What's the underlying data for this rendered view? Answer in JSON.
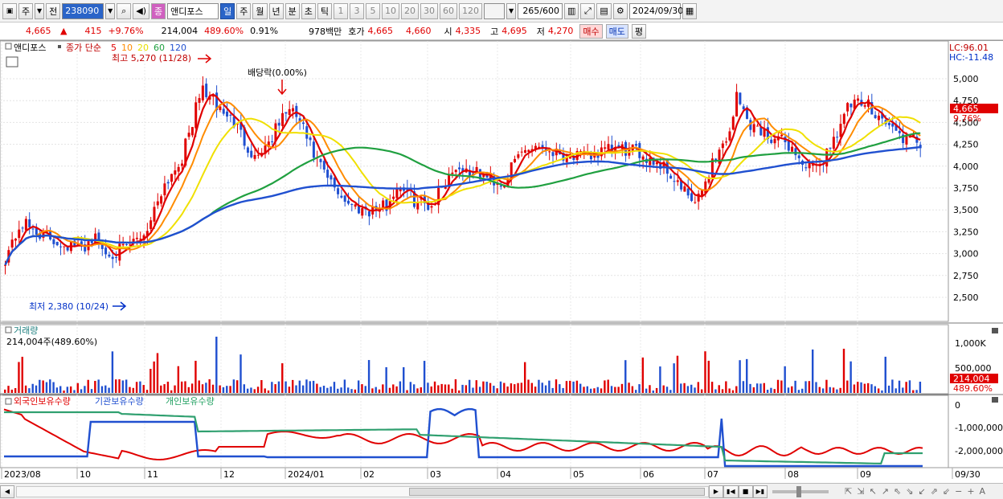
{
  "toolbar": {
    "tab_week": "주",
    "tab_prev": "전",
    "code": "238090",
    "stock_name": "앤디포스",
    "stock_badge": "종",
    "periods": [
      "일",
      "주",
      "월",
      "년",
      "분",
      "초",
      "틱"
    ],
    "period_selected": "일",
    "minute_units": [
      "1",
      "3",
      "5",
      "10",
      "20",
      "30",
      "60",
      "120"
    ],
    "count": "265",
    "count_total": "/600",
    "date": "2024/09/30"
  },
  "quote": {
    "price": "4,665",
    "change": "415",
    "change_pct": "+9.76%",
    "volume": "214,004",
    "vol_pct": "489.60%",
    "turnover": "0.91%",
    "amount": "978백만",
    "bid_label": "호가",
    "ask_price": "4,665",
    "bid_price": "4,660",
    "open_label": "시",
    "open": "4,335",
    "high_label": "고",
    "high": "4,695",
    "low_label": "저",
    "low": "4,270",
    "buy_button": "매수",
    "sell_button": "매도",
    "eval_button": "평"
  },
  "price_panel": {
    "legend_name": "앤디포스",
    "legend_series": "종가 단순",
    "ma_labels": [
      {
        "label": "5",
        "color": "#e00000"
      },
      {
        "label": "10",
        "color": "#ff8c00"
      },
      {
        "label": "20",
        "color": "#e8e000"
      },
      {
        "label": "60",
        "color": "#20a040"
      },
      {
        "label": "120",
        "color": "#2050d0"
      }
    ],
    "high_note": "최고 5,270 (11/28)",
    "low_note": "최저 2,380 (10/24)",
    "dividend_note": "배당락(0.00%)",
    "lc": "LC:96.01",
    "hc": "HC:-11.48",
    "last_price_badge": "4,665",
    "last_pct_badge": "9.76%",
    "y_ticks": [
      "5,000",
      "4,750",
      "4,500",
      "4,250",
      "4,000",
      "3,750",
      "3,500",
      "3,250",
      "3,000",
      "2,750",
      "2,500"
    ]
  },
  "volume_panel": {
    "title": "거래량",
    "value": "214,004주(489.60%)",
    "y_ticks": [
      "1,000K",
      "500,000"
    ],
    "badge_value": "214,004",
    "badge_pct": "489.60%"
  },
  "holding_panel": {
    "series": [
      {
        "name": "외국인보유수량",
        "color": "#e00000"
      },
      {
        "name": "기관보유수량",
        "color": "#2050d0"
      },
      {
        "name": "개인보유수량",
        "color": "#20a060"
      }
    ],
    "y_ticks": [
      "0",
      "-1,000,000",
      "-2,000,000"
    ]
  },
  "x_axis": [
    "2023/08",
    "10",
    "11",
    "12",
    "2024/01",
    "02",
    "03",
    "04",
    "05",
    "06",
    "07",
    "08",
    "09",
    "09/30"
  ]
}
